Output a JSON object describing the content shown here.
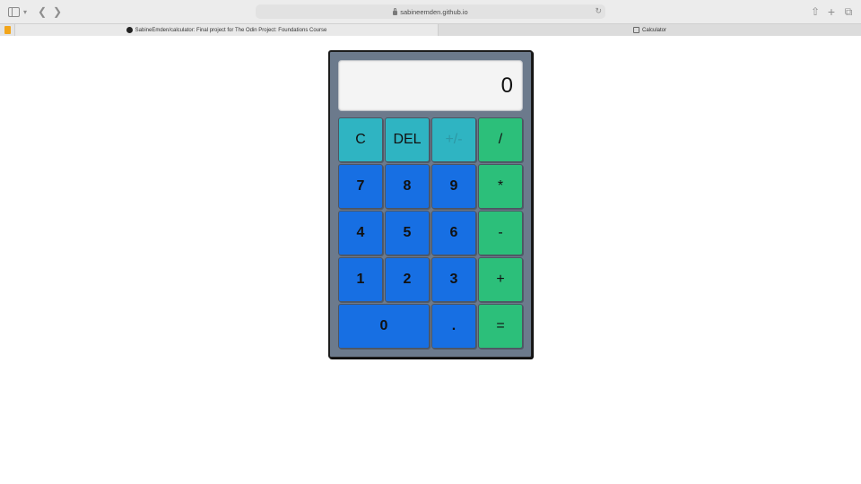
{
  "browser": {
    "url": "sabineemden.github.io",
    "tabs": [
      {
        "label": "SabineEmden/calculator: Final project for The Odin Project: Foundations Course"
      },
      {
        "label": "Calculator"
      }
    ]
  },
  "calculator": {
    "display": "0",
    "buttons": {
      "clear": "C",
      "delete": "DEL",
      "sign": "+/-",
      "divide": "/",
      "seven": "7",
      "eight": "8",
      "nine": "9",
      "multiply": "*",
      "four": "4",
      "five": "5",
      "six": "6",
      "subtract": "-",
      "one": "1",
      "two": "2",
      "three": "3",
      "add": "+",
      "zero": "0",
      "decimal": ".",
      "equals": "="
    }
  },
  "colors": {
    "function_key": "#2fb4c2",
    "number_key": "#176fe3",
    "operator_key": "#2cbf7a",
    "calculator_body": "#6c7a8c"
  }
}
